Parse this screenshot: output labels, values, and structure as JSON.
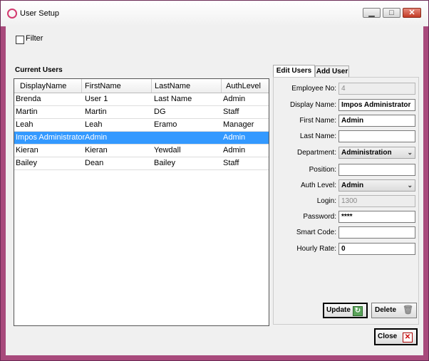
{
  "window": {
    "title": "User Setup",
    "buttons": {
      "minimize": "▁",
      "maximize": "□",
      "close": "✕"
    }
  },
  "filter": {
    "label": "Filter",
    "checked": false
  },
  "current_users": {
    "label": "Current Users",
    "columns": [
      "DisplayName",
      "FirstName",
      "LastName",
      "AuthLevel"
    ],
    "rows": [
      [
        "Brenda",
        "User 1",
        "Last Name",
        "Admin"
      ],
      [
        "Martin",
        "Martin",
        "DG",
        "Staff"
      ],
      [
        "Leah",
        "Leah",
        "Eramo",
        "Manager"
      ],
      [
        "Impos Administrator",
        "Admin",
        "",
        "Admin"
      ],
      [
        "Kieran",
        "Kieran",
        "Yewdall",
        "Admin"
      ],
      [
        "Bailey",
        "Dean",
        "Bailey",
        "Staff"
      ]
    ],
    "selected_row": 3
  },
  "tabs": [
    {
      "label": "Edit Users",
      "active": true
    },
    {
      "label": "Add User",
      "active": false
    }
  ],
  "form": {
    "employee_no": {
      "label": "Employee No:",
      "value": "4"
    },
    "display_name": {
      "label": "Display Name:",
      "value": "Impos Administrator"
    },
    "first_name": {
      "label": "First Name:",
      "value": "Admin"
    },
    "last_name": {
      "label": "Last Name:",
      "value": ""
    },
    "department": {
      "label": "Department:",
      "value": "Administration"
    },
    "position": {
      "label": "Position:",
      "value": ""
    },
    "auth_level": {
      "label": "Auth Level:",
      "value": "Admin"
    },
    "login": {
      "label": "Login:",
      "value": "1300"
    },
    "password": {
      "label": "Password:",
      "value": "****"
    },
    "smart_code": {
      "label": "Smart Code:",
      "value": ""
    },
    "hourly_rate": {
      "label": "Hourly Rate:",
      "value": "0"
    }
  },
  "buttons": {
    "update": "Update",
    "delete": "Delete",
    "close": "Close"
  },
  "colors": {
    "selection": "#3399ff",
    "window_border": "#a84a7c"
  }
}
